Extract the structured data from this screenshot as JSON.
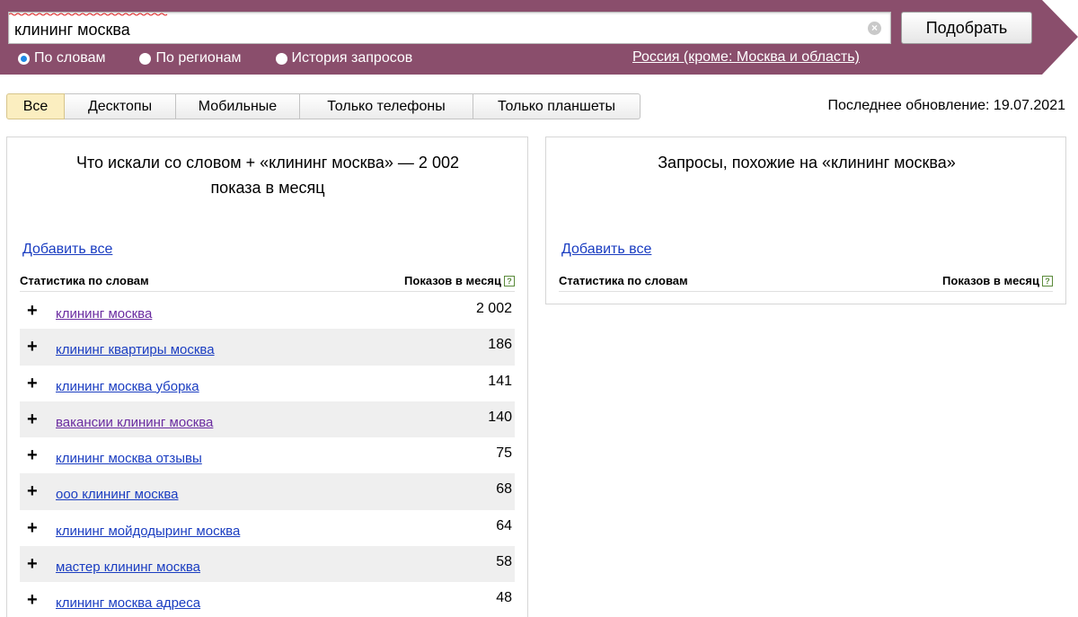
{
  "search": {
    "query": "клининг москва",
    "submit_label": "Подобрать"
  },
  "modes": [
    {
      "label": "По словам",
      "selected": true
    },
    {
      "label": "По регионам",
      "selected": false
    },
    {
      "label": "История запросов",
      "selected": false
    }
  ],
  "region": "Россия (кроме: Москва и область)",
  "tabs": [
    {
      "label": "Все",
      "active": true
    },
    {
      "label": "Десктопы",
      "active": false
    },
    {
      "label": "Мобильные",
      "active": false
    },
    {
      "label": "Только телефоны",
      "active": false
    },
    {
      "label": "Только планшеты",
      "active": false
    }
  ],
  "last_update": "Последнее обновление: 19.07.2021",
  "left_panel": {
    "title": "Что искали со словом  +  «клининг москва» — 2 002 показа в месяц",
    "add_all": "Добавить все",
    "col_words": "Статистика по словам",
    "col_count": "Показов в месяц",
    "rows": [
      {
        "phrase": "клининг москва",
        "count": "2 002",
        "visited": true
      },
      {
        "phrase": "клининг квартиры москва",
        "count": "186",
        "visited": false
      },
      {
        "phrase": "клининг москва уборка",
        "count": "141",
        "visited": false
      },
      {
        "phrase": "вакансии клининг москва",
        "count": "140",
        "visited": true
      },
      {
        "phrase": "клининг москва отзывы",
        "count": "75",
        "visited": false
      },
      {
        "phrase": "ооо клининг москва",
        "count": "68",
        "visited": false
      },
      {
        "phrase": "клининг мойдодыринг москва",
        "count": "64",
        "visited": false
      },
      {
        "phrase": "мастер клининг москва",
        "count": "58",
        "visited": false
      },
      {
        "phrase": "клининг москва адреса",
        "count": "48",
        "visited": false
      }
    ]
  },
  "right_panel": {
    "title": "Запросы, похожие на «клининг москва»",
    "add_all": "Добавить все",
    "col_words": "Статистика по словам",
    "col_count": "Показов в месяц"
  },
  "icons": {
    "clear": "clear-circle-icon",
    "plus": "plus-icon",
    "help": "help-icon"
  },
  "colors": {
    "header_band": "#8a4e6c",
    "link": "#1a3dc1",
    "visited_link": "#6a2ba0",
    "active_tab": "#fbeec0"
  }
}
